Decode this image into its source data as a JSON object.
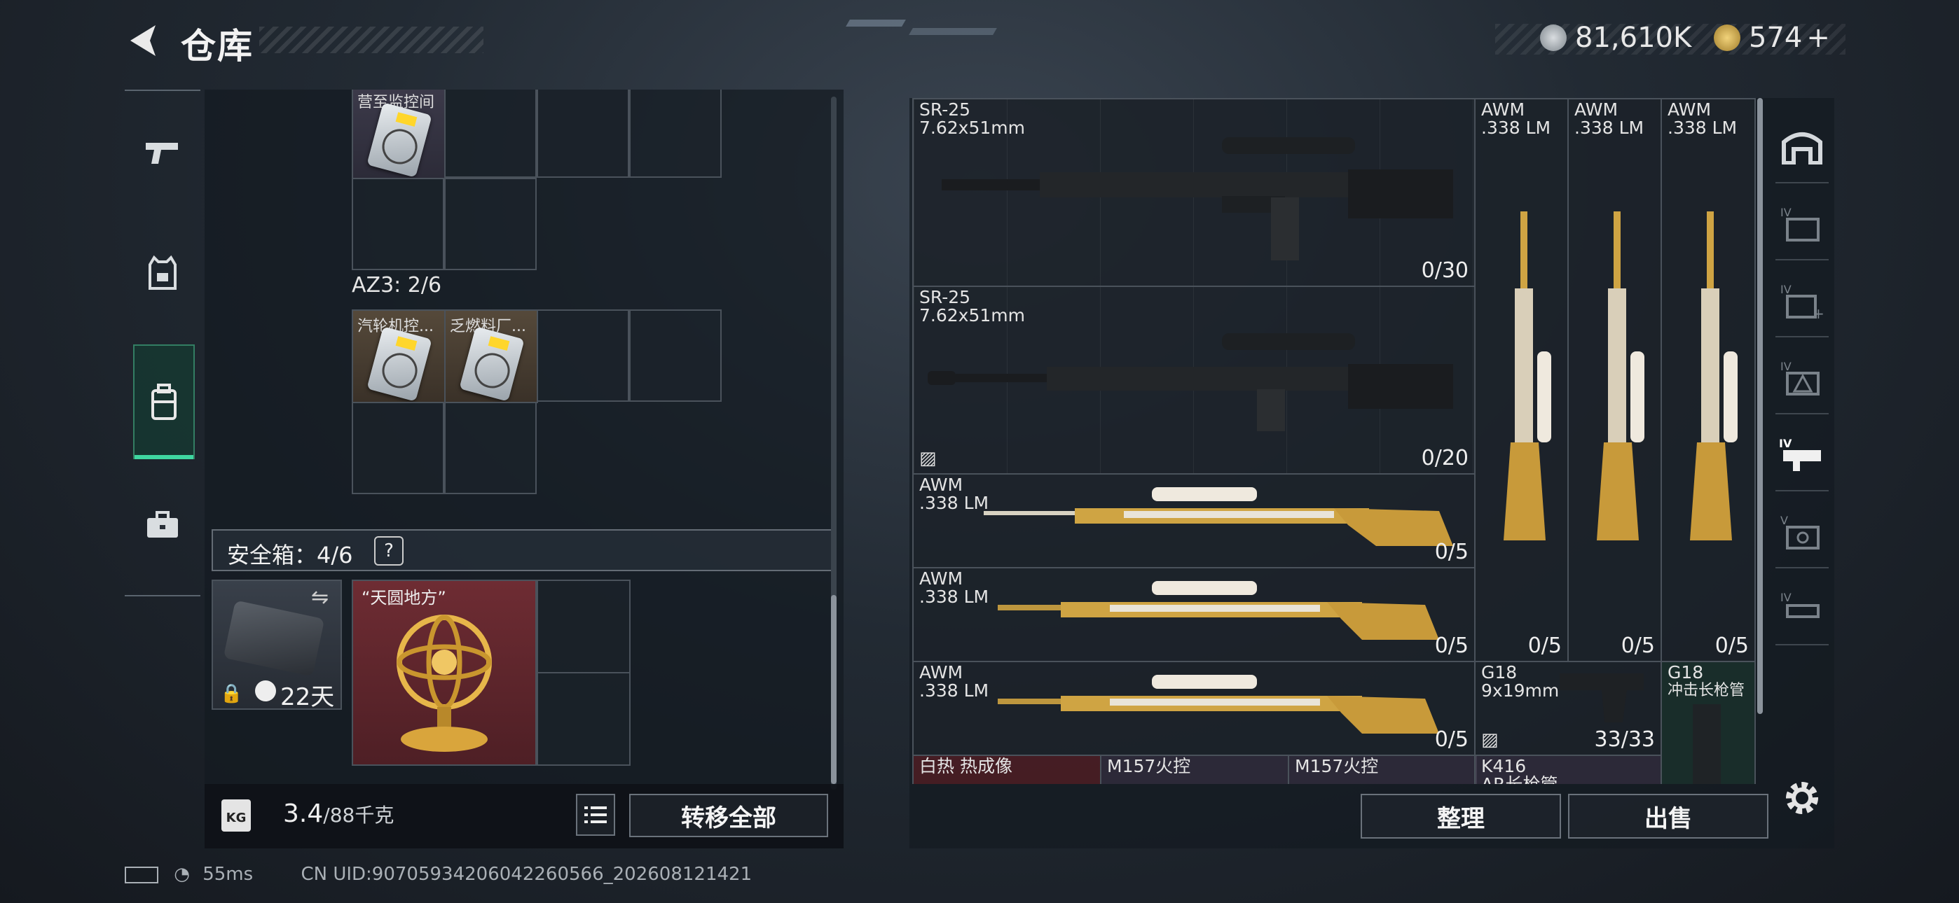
{
  "header": {
    "title": "仓库",
    "currency_silver": "81,610K",
    "currency_gold": "574",
    "add_symbol": "+"
  },
  "left_nav": {
    "items": [
      {
        "name": "weapons",
        "icon": "pistol-icon"
      },
      {
        "name": "armor",
        "icon": "vest-icon"
      },
      {
        "name": "backpack",
        "icon": "backpack-icon"
      },
      {
        "name": "case",
        "icon": "briefcase-icon"
      }
    ],
    "active_index": 2
  },
  "inventory": {
    "partial_label": "营至监控间",
    "az3_label": "AZ3: 2/6",
    "az3_items": [
      {
        "label": "汽轮机控..."
      },
      {
        "label": "乏燃料厂..."
      }
    ],
    "safe_box": {
      "title": "安全箱：4/6",
      "help": "?",
      "case_days": "22天",
      "item_name": "“天圆地方”"
    },
    "weight_current": "3.4",
    "weight_max": "/88千克",
    "transfer_all": "转移全部"
  },
  "stash": {
    "weapons": [
      {
        "name": "SR-25",
        "ammo": "7.62x51mm",
        "count": "0/30"
      },
      {
        "name": "SR-25",
        "ammo": "7.62x51mm",
        "count": "0/20"
      },
      {
        "name": "AWM",
        "ammo": ".338 LM",
        "count": "0/5"
      },
      {
        "name": "AWM",
        "ammo": ".338 LM",
        "count": "0/5"
      },
      {
        "name": "AWM",
        "ammo": ".338 LM",
        "count": "0/5"
      },
      {
        "name": "AWM",
        "ammo": ".338 LM",
        "count": "0/5"
      },
      {
        "name": "AWM",
        "ammo": ".338 LM",
        "count": "0/5"
      },
      {
        "name": "AWM",
        "ammo": ".338 LM",
        "count": "0/5"
      },
      {
        "name": "G18",
        "ammo": "9x19mm",
        "count": "33/33"
      },
      {
        "name": "G18",
        "ammo": "冲击长枪管",
        "count": ""
      }
    ],
    "bottom_row": [
      "白热 热成像",
      "M157火控",
      "M157火控",
      "K416"
    ],
    "bottom_row_sub": "AR长枪管",
    "sort_button": "整理",
    "sell_button": "出售"
  },
  "footer": {
    "ping": "55ms",
    "uid": "CN UID:907059342060422605​66_202608121421"
  },
  "colors": {
    "accent": "#3fd6a0",
    "gold": "#d4a640",
    "selected_red": "#6a2a30"
  }
}
